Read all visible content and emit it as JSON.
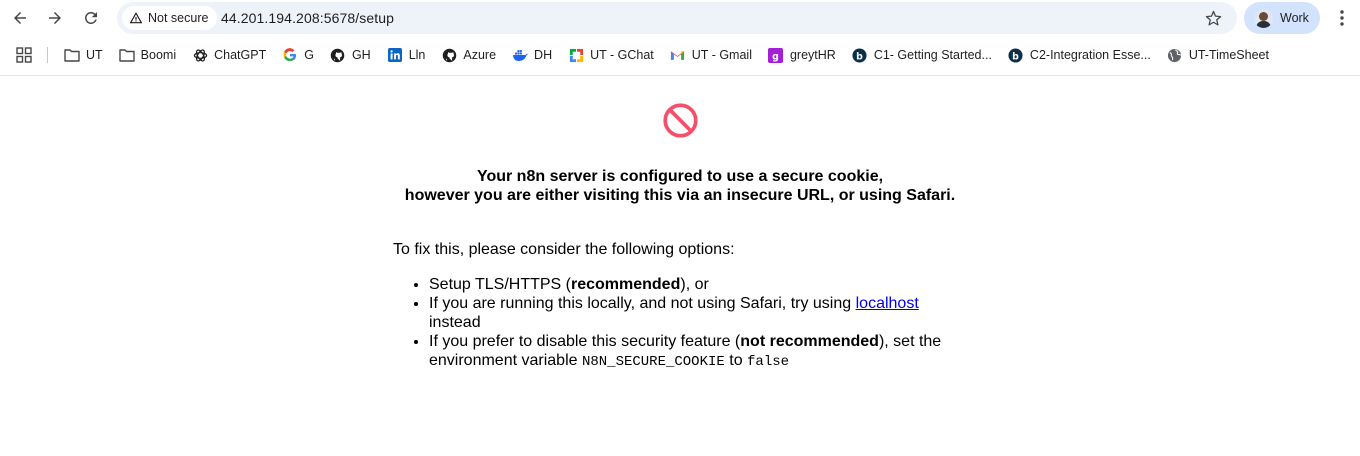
{
  "browser": {
    "security_label": "Not secure",
    "url": "44.201.194.208:5678/setup",
    "profile_label": "Work"
  },
  "bookmarks": [
    {
      "label": "UT",
      "icon": "folder-icon"
    },
    {
      "label": "Boomi",
      "icon": "folder-icon"
    },
    {
      "label": "ChatGPT",
      "icon": "chatgpt-icon"
    },
    {
      "label": "G",
      "icon": "google-icon"
    },
    {
      "label": "GH",
      "icon": "github-icon"
    },
    {
      "label": "Lln",
      "icon": "linkedin-icon"
    },
    {
      "label": "Azure",
      "icon": "github-icon"
    },
    {
      "label": "DH",
      "icon": "docker-icon"
    },
    {
      "label": "UT - GChat",
      "icon": "gchat-icon"
    },
    {
      "label": "UT - Gmail",
      "icon": "gmail-icon"
    },
    {
      "label": "greytHR",
      "icon": "greythr-icon"
    },
    {
      "label": "C1- Getting Started...",
      "icon": "boomi-b-icon"
    },
    {
      "label": "C2-Integration Esse...",
      "icon": "boomi-b-icon"
    },
    {
      "label": "UT-TimeSheet",
      "icon": "globe-icon"
    }
  ],
  "page": {
    "headline_line1": "Your n8n server is configured to use a secure cookie,",
    "headline_line2": "however you are either visiting this via an insecure URL, or using Safari.",
    "fix_intro": "To fix this, please consider the following options:",
    "option1_pre": "Setup TLS/HTTPS (",
    "option1_bold": "recommended",
    "option1_post": "), or",
    "option2_pre": "If you are running this locally, and not using Safari, try using ",
    "option2_link": "localhost",
    "option2_post": " instead",
    "option3_pre": "If you prefer to disable this security feature (",
    "option3_bold": "not recommended",
    "option3_mid": "), set the environment variable ",
    "option3_code1": "N8N_SECURE_COOKIE",
    "option3_to": " to ",
    "option3_code2": "false"
  },
  "colors": {
    "error_icon": "#f2506b",
    "link": "#0000ee",
    "omnibox_bg": "#eef2f9",
    "profile_bg": "#d3e3fd"
  }
}
